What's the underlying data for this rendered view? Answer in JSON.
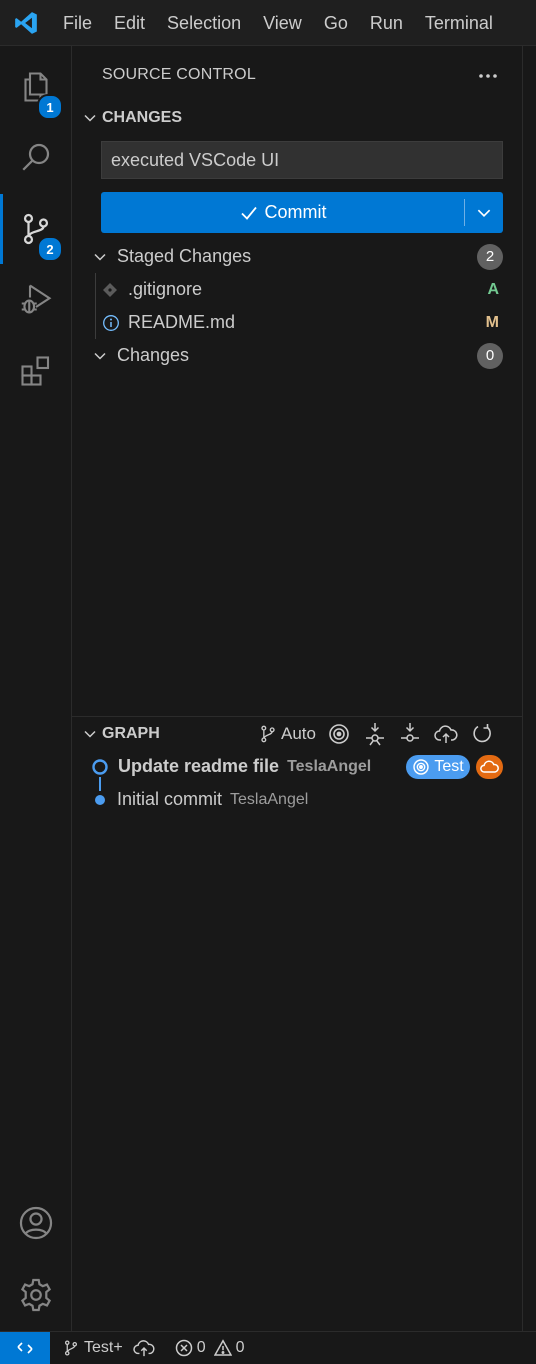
{
  "menu": [
    "File",
    "Edit",
    "Selection",
    "View",
    "Go",
    "Run",
    "Terminal"
  ],
  "activity": {
    "explorer_badge": "1",
    "scm_badge": "2"
  },
  "panel": {
    "title": "SOURCE CONTROL",
    "section": "CHANGES",
    "message_value": "executed VSCode UI",
    "commit_label": "Commit",
    "staged": {
      "label": "Staged Changes",
      "count": "2",
      "files": [
        {
          "name": ".gitignore",
          "status": "A",
          "status_color": "#73c991"
        },
        {
          "name": "README.md",
          "status": "M",
          "status_color": "#e2c08d"
        }
      ]
    },
    "changes": {
      "label": "Changes",
      "count": "0"
    }
  },
  "graph": {
    "title": "GRAPH",
    "mode_label": "Auto",
    "commits": [
      {
        "message": "Update readme file",
        "author": "TeslaAngel",
        "branch": "Test"
      },
      {
        "message": "Initial commit",
        "author": "TeslaAngel"
      }
    ]
  },
  "status": {
    "branch": "Test+",
    "errors": "0",
    "warnings": "0"
  },
  "colors": {
    "accent": "#0078d4",
    "branch_pill": "#4b9cf0",
    "remote_pill": "#e36a12"
  }
}
